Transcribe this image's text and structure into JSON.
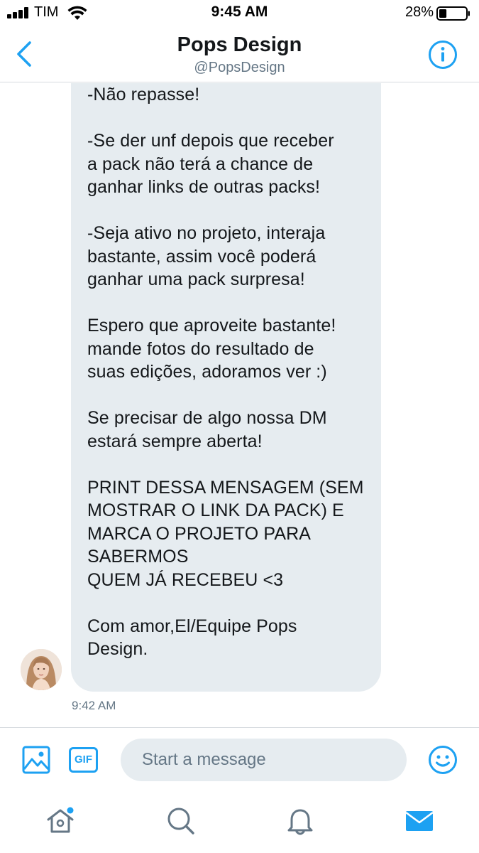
{
  "status_bar": {
    "carrier": "TIM",
    "time": "9:45 AM",
    "battery_percent": "28%",
    "battery_level": 0.28
  },
  "header": {
    "title": "Pops Design",
    "handle": "@PopsDesign",
    "back_icon": "chevron-left-icon",
    "info_icon": "info-icon"
  },
  "message": {
    "paragraphs": [
      "-Não repasse!",
      "-Se der unf depois que receber\na pack não terá a chance de\nganhar links de outras packs!",
      "-Seja ativo no projeto, interaja\nbastante, assim você poderá\nganhar uma pack surpresa!",
      "Espero que aproveite bastante!\nmande fotos do resultado de\nsuas edições, adoramos ver :)",
      "Se precisar de algo nossa DM\nestará sempre aberta!",
      "PRINT DESSA MENSAGEM (SEM\nMOSTRAR O LINK DA PACK) E\nMARCA O PROJETO PARA\nSABERMOS\nQUEM JÁ RECEBEU <3",
      "Com amor,El/Equipe Pops\nDesign."
    ],
    "timestamp": "9:42 AM"
  },
  "composer": {
    "gif_label": "GIF",
    "placeholder": "Start a message"
  },
  "tabs": [
    {
      "icon": "home-icon",
      "has_badge": true
    },
    {
      "icon": "search-icon"
    },
    {
      "icon": "bell-icon"
    },
    {
      "icon": "mail-icon",
      "active": true
    }
  ],
  "colors": {
    "accent": "#1da1f2",
    "bubble": "#e6ecf0",
    "secondary_text": "#657786"
  }
}
